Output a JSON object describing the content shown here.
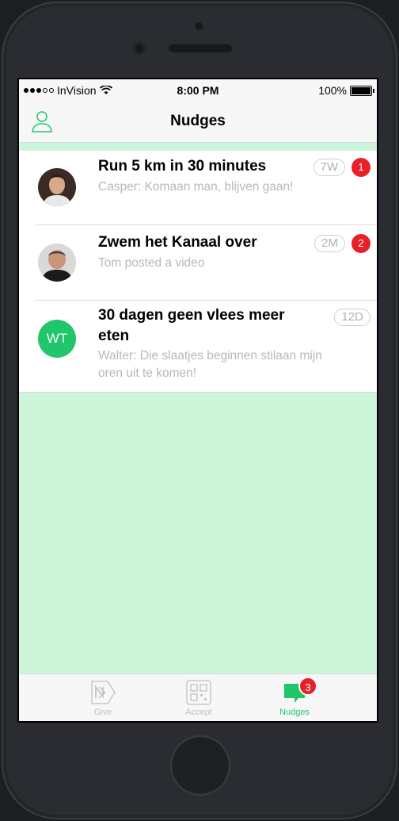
{
  "status_bar": {
    "carrier": "InVision",
    "time": "8:00 PM",
    "battery": "100%",
    "icons": [
      "signal-dots-icon",
      "wifi-icon",
      "battery-icon"
    ]
  },
  "nav": {
    "title": "Nudges",
    "left_icon": "profile-icon"
  },
  "nudges": [
    {
      "avatar": "photo",
      "title": "Run 5 km in 30 minutes",
      "subtitle": "Casper: Komaan man, blijven gaan!",
      "age": "7W",
      "unread": "1"
    },
    {
      "avatar": "photo",
      "title": "Zwem het Kanaal over",
      "subtitle": "Tom posted a video",
      "age": "2M",
      "unread": "2"
    },
    {
      "avatar_initials": "WT",
      "title_line1": "30 dagen geen vlees meer",
      "title_line2": "eten",
      "subtitle_line1": "Walter: Die slaatjes beginnen stilaan mijn",
      "subtitle_line2": "oren uit te komen!",
      "age": "12D"
    }
  ],
  "tabs": [
    {
      "label": "Give",
      "icon": "give-icon"
    },
    {
      "label": "Accept",
      "icon": "qr-code-icon"
    },
    {
      "label": "Nudges",
      "icon": "chat-bubble-icon",
      "badge": "3"
    }
  ],
  "colors": {
    "accent": "#1fc66b",
    "badge": "#e8202a",
    "screen_bg": "#cdf5d9"
  }
}
